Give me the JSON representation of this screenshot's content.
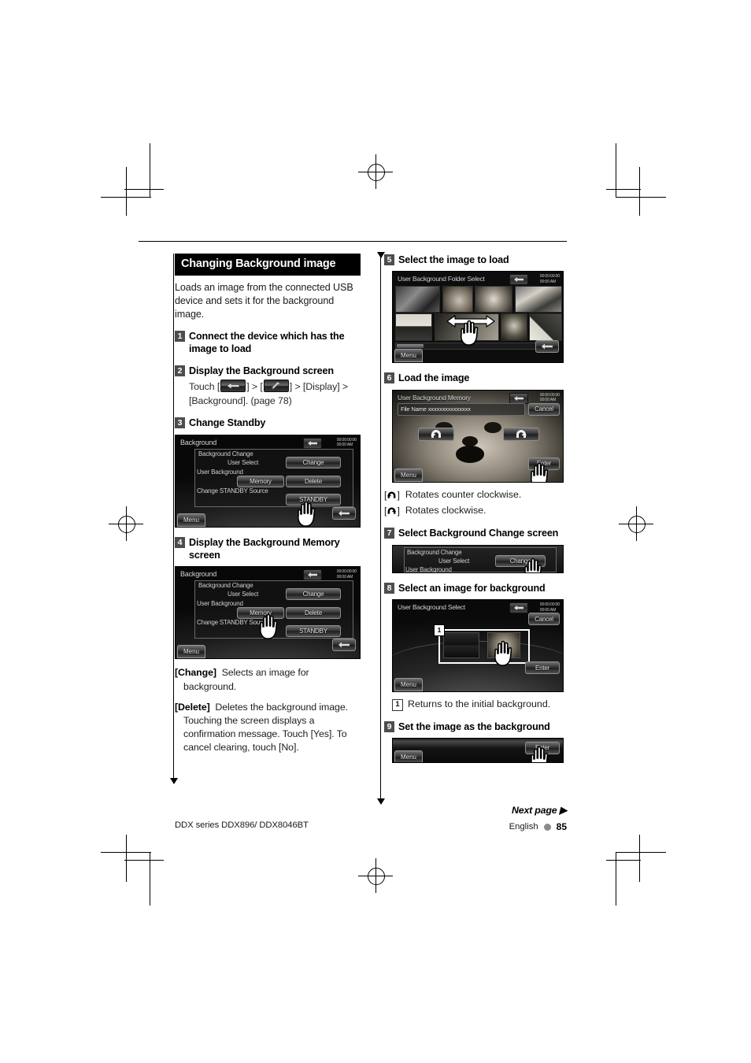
{
  "document": {
    "footer_model": "DDX series   DDX896/ DDX8046BT",
    "footer_next_page": "Next page ▶",
    "footer_language": "English",
    "footer_page_number": "85"
  },
  "section": {
    "title": "Changing Background image",
    "intro": "Loads an image from the connected USB device and sets it for the background image."
  },
  "steps": [
    {
      "num": "1",
      "title": "Connect the device which has the image to load"
    },
    {
      "num": "2",
      "title": "Display the Background screen",
      "sub_prefix": "Touch [",
      "sub_mid1": "] > [",
      "sub_mid2": "] > [Display] >",
      "sub_tail": "[Background]. (page 78)"
    },
    {
      "num": "3",
      "title": "Change Standby"
    },
    {
      "num": "4",
      "title": "Display the Background Memory screen"
    },
    {
      "num": "5",
      "title": "Select the image to load"
    },
    {
      "num": "6",
      "title": "Load the image"
    },
    {
      "num": "7",
      "title": "Select Background Change screen"
    },
    {
      "num": "8",
      "title": "Select an image for background"
    },
    {
      "num": "9",
      "title": "Set the image as the background"
    }
  ],
  "definitions": [
    {
      "term": "[Change]",
      "text": "Selects an image for",
      "cont": "background."
    },
    {
      "term": "[Delete]",
      "text": "Deletes the background image.",
      "cont": "Touching the screen displays a confirmation message. Touch [Yes]. To cancel clearing, touch [No]."
    }
  ],
  "rotate_notes": [
    {
      "glyph": "counter",
      "text": "Rotates counter clockwise."
    },
    {
      "glyph": "clockwise",
      "text": "Rotates clockwise."
    }
  ],
  "numbered_notes": [
    {
      "num": "1",
      "text": "Returns to the initial background."
    }
  ],
  "screens": {
    "background": {
      "title": "Background",
      "clock_line1": "00:00:00:00",
      "clock_line2": "00:00 AM",
      "row1_label": "Background Change",
      "row1_sub": "User Select",
      "row1_button": "Change",
      "row2_label": "User Background",
      "row2_button1": "Memory",
      "row2_button2": "Delete",
      "row3_label": "Change STANDBY Source",
      "row3_button": "STANDBY",
      "menu": "Menu"
    },
    "folder_select": {
      "title": "User Background Folder Select",
      "clock_line1": "00:00:00:00",
      "clock_line2": "00:00 AM",
      "menu": "Menu"
    },
    "memory": {
      "title": "User Background Memory",
      "clock_line1": "00:00:00:00",
      "clock_line2": "00:00 AM",
      "file_name": "File Name xxxxxxxxxxxxxxx",
      "cancel": "Cancel",
      "enter": "Enter",
      "menu": "Menu"
    },
    "change_crop": {
      "row1_label": "Background Change",
      "row1_sub": "User Select",
      "row1_button": "Change",
      "row2_label": "User Background"
    },
    "user_select": {
      "title": "User Background Select",
      "clock_line1": "00:00:00:00",
      "clock_line2": "00:00 AM",
      "cancel": "Cancel",
      "enter": "Enter",
      "menu": "Menu",
      "badge": "1"
    },
    "set_bg": {
      "enter": "Enter",
      "menu": "Menu"
    }
  },
  "icons": {
    "return_key": "return-arrow-icon",
    "setup_key": "setup-tool-icon",
    "hand": "pointing-hand-icon",
    "rotate_ccw": "rotate-counter-clockwise-icon",
    "rotate_cw": "rotate-clockwise-icon"
  },
  "colors": {
    "section_bar_bg": "#000000",
    "step_num_bg": "#4d4d4d",
    "page_bg": "#ffffff",
    "footer_dot": "#8a8a8a"
  }
}
